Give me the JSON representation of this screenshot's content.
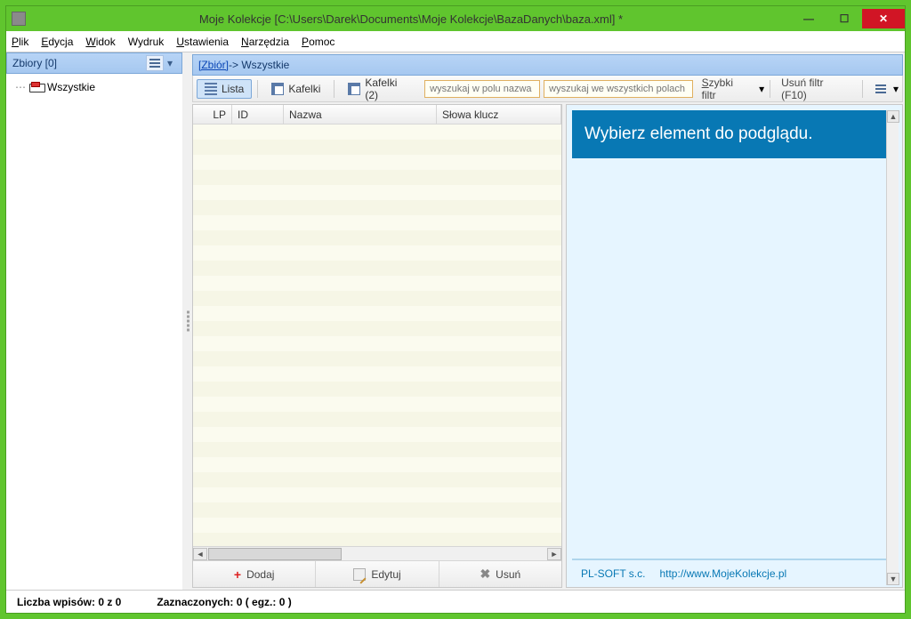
{
  "window": {
    "title": "Moje Kolekcje [C:\\Users\\Darek\\Documents\\Moje Kolekcje\\BazaDanych\\baza.xml] *"
  },
  "menu": {
    "plik": "Plik",
    "edycja": "Edycja",
    "widok": "Widok",
    "wydruk": "Wydruk",
    "ustawienia": "Ustawienia",
    "narzedzia": "Narzędzia",
    "pomoc": "Pomoc"
  },
  "sidebar": {
    "header": "Zbiory [0]",
    "item0": "Wszystkie"
  },
  "main_header": {
    "link": "[Zbiór]",
    "suffix": " -> Wszystkie"
  },
  "toolbar": {
    "lista": "Lista",
    "kafelki": "Kafelki",
    "kafelki2": "Kafelki (2)",
    "search_name_placeholder": "wyszukaj w polu nazwa",
    "search_all_placeholder": "wyszukaj we wszystkich polach",
    "quick_filter": "Szybki filtr",
    "clear_filter": "Usuń filtr (F10)"
  },
  "columns": {
    "lp": "LP",
    "id": "ID",
    "nazwa": "Nazwa",
    "slowa": "Słowa klucz"
  },
  "actions": {
    "add": "Dodaj",
    "edit": "Edytuj",
    "delete": "Usuń"
  },
  "preview": {
    "head": "Wybierz element do podglądu.",
    "company": "PL-SOFT s.c.",
    "link": "http://www.MojeKolekcje.pl"
  },
  "status": {
    "count": "Liczba wpisów: 0 z 0",
    "selected": "Zaznaczonych: 0 (  egz.: 0 )"
  }
}
